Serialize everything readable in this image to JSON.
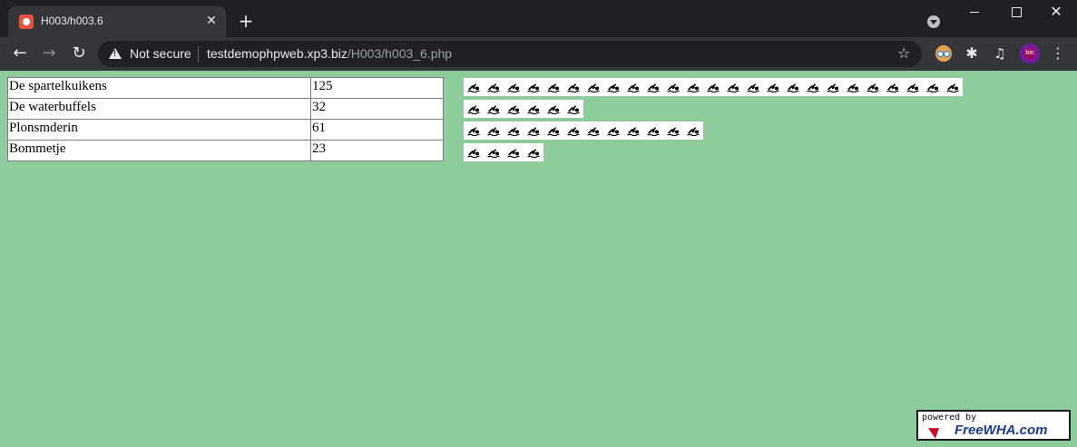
{
  "browser": {
    "tab_title": "H003/h003.6",
    "security_label": "Not secure",
    "url_host": "testdemophpweb.xp3.biz",
    "url_path": "/H003/h003_6.php",
    "avatar_text": "bin"
  },
  "icons": {
    "tab_favicon": "favicon-icon",
    "swimmer": "swimmer-icon",
    "warning": "warning-icon",
    "star": "star-icon"
  },
  "colors": {
    "page_background": "#8ecc9e",
    "chrome_dark": "#202124",
    "chrome_toolbar": "#35363a"
  },
  "teams": [
    {
      "name": "De spartelkuikens",
      "score": "125",
      "icon_count": 25
    },
    {
      "name": "De waterbuffels",
      "score": "32",
      "icon_count": 6
    },
    {
      "name": "Plonsmderin",
      "score": "61",
      "icon_count": 12
    },
    {
      "name": "Bommetje",
      "score": "23",
      "icon_count": 4
    }
  ],
  "footer": {
    "powered_label": "powered by",
    "brand": "FreeWHA.com"
  }
}
